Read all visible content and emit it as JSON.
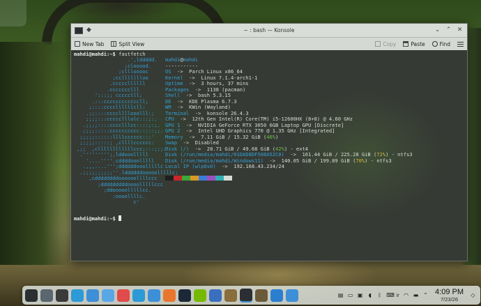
{
  "window": {
    "title": "~ : bash — Konsole"
  },
  "toolbar": {
    "new_tab": "New Tab",
    "split_view": "Split View",
    "copy": "Copy",
    "paste": "Paste",
    "find": "Find"
  },
  "terminal": {
    "prompt1": "mahdi@mahdi:~$ ",
    "command": "fastfetch",
    "prompt2": "mahdi@mahdi:~$ ",
    "logo": "                  .',lddddd.\n                 ;clooood.\n               ;clllooooc\n             ;ccllllllloo\n            .cccccllllll\n           .ccccccclll\n       ':::;; ccccclll;\n      .:::ccccccccccccll;\n     ;::::ccccllllllcll:\n    .;;::::ccccllllooolll:;\n    ;;;;:::ccccclllolc:::;:.\n   .;;;;::::cccclllcc::::;:;.\n   ;;;;:::::cccccccccc:::::;;.\n  ;;;;;::::::llllcccccc:::'\n  ;;;;;:::::; ,cllllcccccc:\n ,;;  ,cllllllllllllccc;:::;;;:'\n  .''''''''';,lddooolllll\n    '....''''.cddddooolllll\n   .,,,....''';ddddddooolllllc\n  .;;;;;;;;;;''.lddddddooooolllllc;\n     ,cddddddddoooooollllccc\n        ;dddddddddoooolllllccc\n          ;ddooooolllllcc.\n             :oooollllc.\n                    c'",
    "info": {
      "user": "mahdi",
      "host": "mahdi",
      "separator": "-----------",
      "rows": [
        {
          "key": "OS",
          "value": "Parch Linux x86_64"
        },
        {
          "key": "Kernel",
          "value": "Linux 7.1.4-arch1-1"
        },
        {
          "key": "Uptime",
          "value": "3 hours, 37 mins"
        },
        {
          "key": "Packages",
          "value": "1138 (pacman)"
        },
        {
          "key": "Shell",
          "value": "bash 5.3.15"
        },
        {
          "key": "DE",
          "value": "KDE Plasma 6.7.3"
        },
        {
          "key": "WM",
          "value": "KWin (Wayland)"
        },
        {
          "key": "Terminal",
          "value": "konsole 26.4.3"
        },
        {
          "key": "CPU",
          "value": "12th Gen Intel(R) Core(TM) i5-12600HX (8+8) @ 4.60 GHz"
        },
        {
          "key": "GPU 1",
          "value": "NVIDIA GeForce RTX 3050 6GB Laptop GPU [Discrete]"
        },
        {
          "key": "GPU 2",
          "value": "Intel UHD Graphics 770 @ 1.35 GHz [Integrated]"
        },
        {
          "key": "Memory",
          "value": "7.11 GiB / 15.32 GiB",
          "pct": "46%",
          "pct_color": "green"
        },
        {
          "key": "Swap",
          "value": "Disabled"
        },
        {
          "key": "Disk (/)",
          "value": "20.71 GiB / 49.68 GiB",
          "pct": "42%",
          "pct_color": "green",
          "suffix": " - ext4"
        },
        {
          "key": "Disk (/run/media/mahdi/01DAD8DF508A52C0)",
          "value": "161.44 GiB / 225.28 GiB",
          "pct": "72%",
          "pct_color": "yellow",
          "suffix": " - ntfs3"
        },
        {
          "key": "Disk (/run/media/mahdi/Windows11)",
          "value": "140.05 GiB / 199.89 GiB",
          "pct": "70%",
          "pct_color": "yellow",
          "suffix": " - ntfs3"
        },
        {
          "key": "Local IP (wlp0s0)",
          "value": "192.168.43.234/24"
        }
      ],
      "swatches": [
        "#1d1f21",
        "#c82829",
        "#3aa83a",
        "#d99a25",
        "#3b7dd8",
        "#9d4fc0",
        "#2fb0b0",
        "#d8dcd6"
      ]
    }
  },
  "taskbar": {
    "apps": [
      {
        "name": "app-launcher-icon",
        "color": "#2a2f33"
      },
      {
        "name": "system-settings-icon",
        "color": "#5a6670"
      },
      {
        "name": "color-palette-icon",
        "color": "#3a3a3a"
      },
      {
        "name": "telegram-icon",
        "color": "#2c9ad6"
      },
      {
        "name": "file-manager-icon",
        "color": "#3d8fd8"
      },
      {
        "name": "browser-blue-icon",
        "color": "#5aa7e6"
      },
      {
        "name": "vivaldi-icon",
        "color": "#e04b4b"
      },
      {
        "name": "send-icon",
        "color": "#2c9ad6"
      },
      {
        "name": "discover-store-icon",
        "color": "#3d8fd8"
      },
      {
        "name": "firefox-icon",
        "color": "#e8762d"
      },
      {
        "name": "steam-icon",
        "color": "#1b2838"
      },
      {
        "name": "nvidia-icon",
        "color": "#76b900"
      },
      {
        "name": "cube-app-icon",
        "color": "#3a6fbf"
      },
      {
        "name": "image-viewer-icon",
        "color": "#8a6d3b"
      },
      {
        "name": "konsole-icon",
        "color": "#2b2f33"
      },
      {
        "name": "gimp-icon",
        "color": "#6b5a3a"
      },
      {
        "name": "vscode-icon",
        "color": "#2a7fd0"
      },
      {
        "name": "kde-connect-icon",
        "color": "#3d8fd8"
      }
    ],
    "tray_lang": "ir",
    "clock_time": "4:09 PM",
    "clock_date": "7/23/26"
  }
}
